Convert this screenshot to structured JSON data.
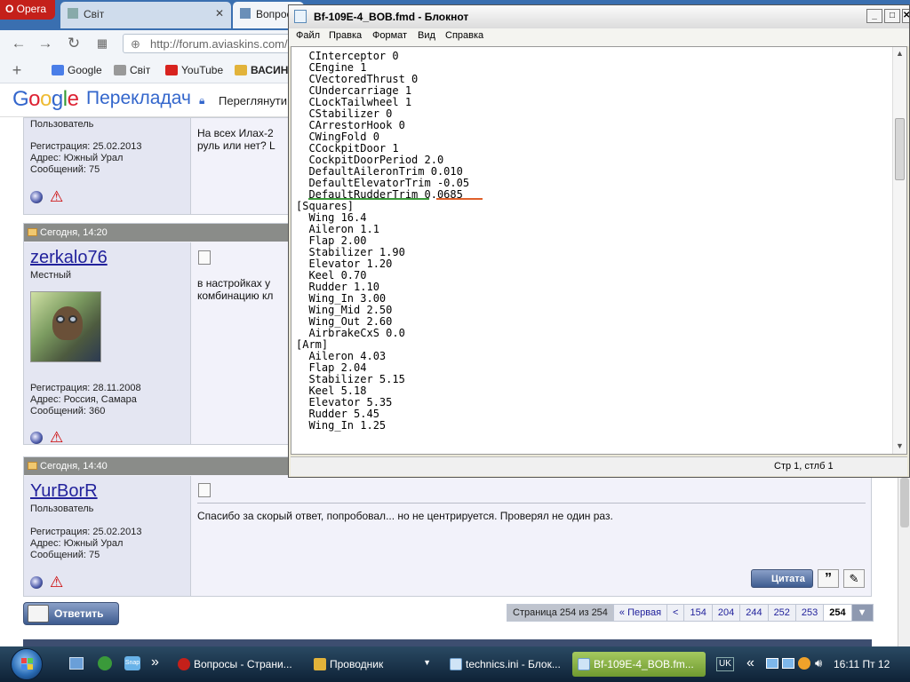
{
  "browser": {
    "opera_label": "Opera",
    "tabs": [
      {
        "label": "Світ"
      },
      {
        "label": "Вопрос"
      }
    ],
    "url": "http://forum.aviaskins.com/",
    "bookmarks": [
      "Google",
      "Світ",
      "YouTube",
      "ВАСИН"
    ],
    "translate_logo": "Google",
    "translate_title": "Перекладач",
    "translate_button": "Переглянути"
  },
  "forum": {
    "posts": [
      {
        "role": "Пользователь",
        "registered": "Регистрация: 25.02.2013",
        "address": "Адрес: Южный Урал",
        "messages": "Сообщений: 75",
        "text": [
          "На всех Илах-2",
          "руль или нет? L"
        ]
      },
      {
        "header": "Сегодня, 14:20",
        "username": "zerkalo76",
        "role": "Местный",
        "registered": "Регистрация: 28.11.2008",
        "address": "Адрес: Россия, Самара",
        "messages": "Сообщений: 360",
        "text": [
          "в настройках у",
          "комбинацию кл"
        ]
      },
      {
        "header": "Сегодня, 14:40",
        "username": "YurBorR",
        "role": "Пользователь",
        "registered": "Регистрация: 25.02.2013",
        "address": "Адрес: Южный Урал",
        "messages": "Сообщений: 75",
        "text": [
          "Спасибо за скорый ответ, попробовал... но не центрируется. Проверял не один раз."
        ],
        "quote_label": "Цитата"
      }
    ],
    "reply_button": "Ответить",
    "pagination": [
      "Страница 254 из 254",
      "« Первая",
      "<",
      "154",
      "204",
      "244",
      "252",
      "253",
      "254"
    ]
  },
  "notepad": {
    "title": "Bf-109E-4_BOB.fmd - Блокнот",
    "menu": [
      "Файл",
      "Правка",
      "Формат",
      "Вид",
      "Справка"
    ],
    "lines": [
      "  CInterceptor 0",
      "  CEngine 1",
      "  CVectoredThrust 0",
      "  CUndercarriage 1",
      "  CLockTailwheel 1",
      "  CStabilizer 0",
      "  CArrestorHook 0",
      "  CWingFold 0",
      "  CCockpitDoor 1",
      "  CockpitDoorPeriod 2.0",
      "  DefaultAileronTrim 0.010",
      "  DefaultElevatorTrim -0.05",
      "  DefaultRudderTrim 0.0685",
      "[Squares]",
      "  Wing 16.4",
      "  Aileron 1.1",
      "  Flap 2.00",
      "  Stabilizer 1.90",
      "  Elevator 1.20",
      "  Keel 0.70",
      "  Rudder 1.10",
      "  Wing_In 3.00",
      "  Wing_Mid 2.50",
      "  Wing_Out 2.60",
      "  AirbrakeCxS 0.0",
      "[Arm]",
      "  Aileron 4.03",
      "  Flap 2.04",
      "  Stabilizer 5.15",
      "  Keel 5.18",
      "  Elevator 5.35",
      "  Rudder 5.45",
      "  Wing_In 1.25"
    ],
    "status": "Стр 1, стлб 1"
  },
  "taskbar": {
    "items": [
      "Вопросы - Страни...",
      "Проводник",
      "technics.ini - Блок...",
      "Bf-109E-4_BOB.fm..."
    ],
    "language": "UK",
    "clock": "16:11 Пт 12"
  }
}
